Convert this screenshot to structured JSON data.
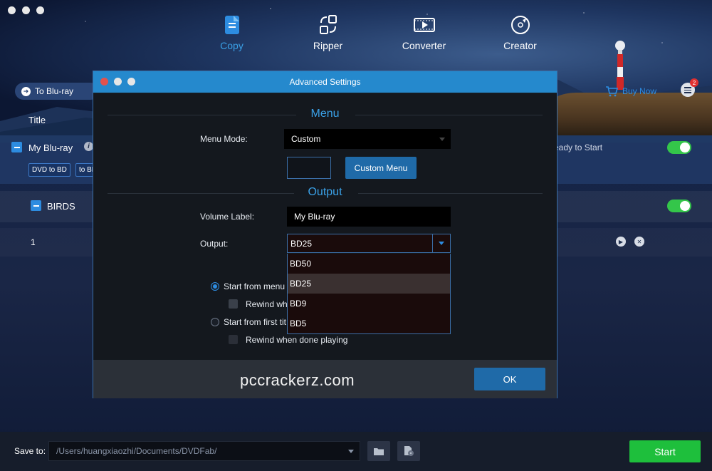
{
  "nav": {
    "items": [
      {
        "label": "Copy",
        "icon": "copy-icon",
        "active": true
      },
      {
        "label": "Ripper",
        "icon": "ripper-icon",
        "active": false
      },
      {
        "label": "Converter",
        "icon": "converter-icon",
        "active": false
      },
      {
        "label": "Creator",
        "icon": "creator-icon",
        "active": false
      }
    ],
    "accent_color": "#3aa0e6"
  },
  "header": {
    "mode_button": "To Blu-ray",
    "buy_now": "Buy Now",
    "notification_count": "2"
  },
  "list": {
    "title_column": "Title",
    "rows": [
      {
        "title": "My Blu-ray",
        "tags": [
          "DVD to BD",
          "to BD"
        ],
        "status": "eady to Start"
      },
      {
        "title": "BIRDS"
      },
      {
        "title": "1"
      }
    ]
  },
  "dialog": {
    "title": "Advanced Settings",
    "menu_section": "Menu",
    "menu_mode_label": "Menu Mode:",
    "menu_mode_value": "Custom",
    "custom_menu_button": "Custom Menu",
    "output_section": "Output",
    "volume_label_label": "Volume Label:",
    "volume_label_value": "My Blu-ray",
    "output_label": "Output:",
    "output_value": "BD25",
    "output_options": [
      "BD50",
      "BD25",
      "BD9",
      "BD5"
    ],
    "selected_option": "BD25",
    "start_from_menu": "Start from menu",
    "rewind_partial": "Rewind wh",
    "start_from_first": "Start from first tit",
    "rewind_when_done": "Rewind when done playing",
    "ok_button": "OK",
    "watermark": "pccrackerz.com"
  },
  "bottom": {
    "save_to_label": "Save to:",
    "save_path": "/Users/huangxiaozhi/Documents/DVDFab/",
    "start_button": "Start"
  },
  "colors": {
    "start_green": "#1ebf3c",
    "dialog_blue": "#2589cd",
    "toggle_green": "#34c64a"
  }
}
